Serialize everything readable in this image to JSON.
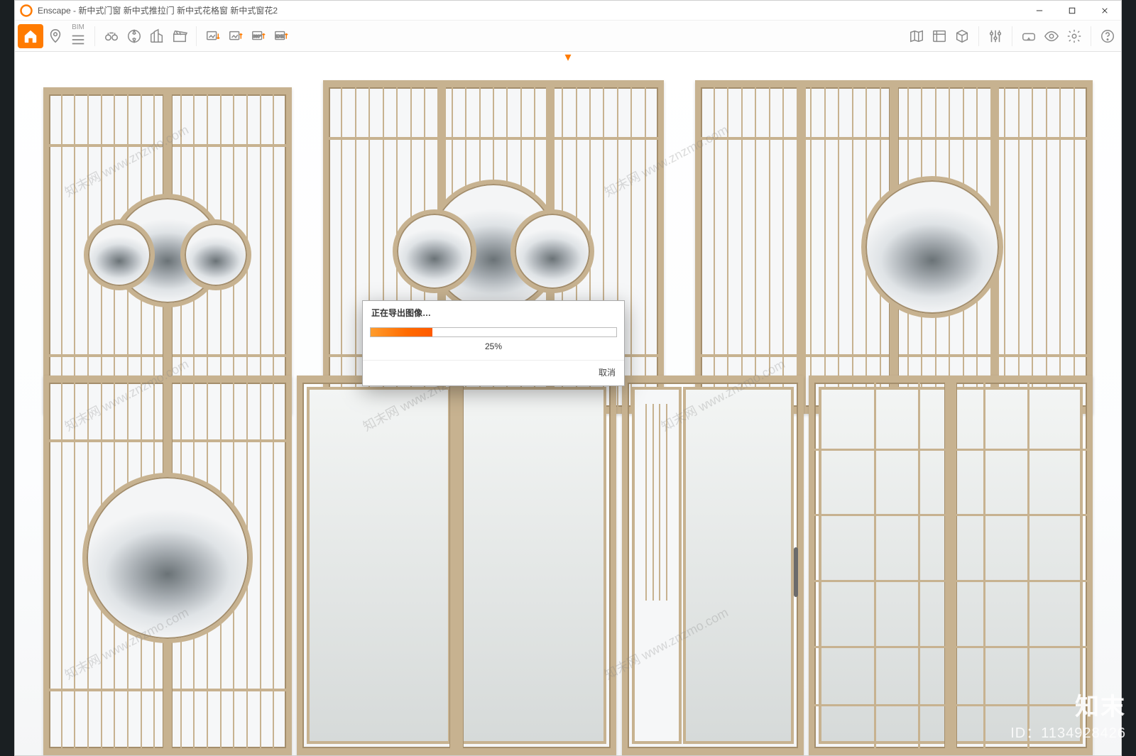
{
  "titlebar": {
    "app": "Enscape",
    "title": "新中式门窗 新中式推拉门 新中式花格窗 新中式窗花2"
  },
  "toolbar": {
    "bim_label": "BIM"
  },
  "dialog": {
    "title": "正在导出图像…",
    "progress_value": 25,
    "progress_text": "25%",
    "cancel": "取消"
  },
  "watermark": {
    "text": "知末网 www.znzmo.com",
    "brand": "知末",
    "id": "ID：1134928426"
  }
}
